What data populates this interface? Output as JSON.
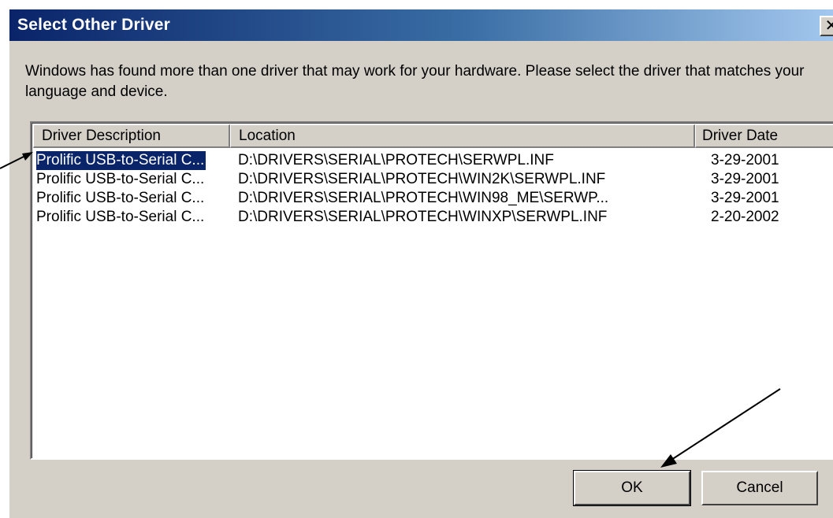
{
  "dialog": {
    "title": "Select Other Driver",
    "close_glyph": "✕",
    "message": "Windows has found more than one driver that may work for your hardware.  Please select the driver that matches your language and device."
  },
  "list": {
    "columns": [
      "Driver Description",
      "Location",
      "Driver Date"
    ],
    "rows": [
      {
        "description": "Prolific USB-to-Serial C...",
        "location": "D:\\DRIVERS\\SERIAL\\PROTECH\\SERWPL.INF",
        "date": "3-29-2001",
        "selected": true
      },
      {
        "description": "Prolific USB-to-Serial C...",
        "location": "D:\\DRIVERS\\SERIAL\\PROTECH\\WIN2K\\SERWPL.INF",
        "date": "3-29-2001",
        "selected": false
      },
      {
        "description": "Prolific USB-to-Serial C...",
        "location": "D:\\DRIVERS\\SERIAL\\PROTECH\\WIN98_ME\\SERWP...",
        "date": "3-29-2001",
        "selected": false
      },
      {
        "description": "Prolific USB-to-Serial C...",
        "location": "D:\\DRIVERS\\SERIAL\\PROTECH\\WINXP\\SERWPL.INF",
        "date": "2-20-2002",
        "selected": false
      }
    ]
  },
  "buttons": {
    "ok": "OK",
    "cancel": "Cancel"
  },
  "colors": {
    "title_bar_start": "#0a246a",
    "title_bar_end": "#a6caf0",
    "dialog_face": "#d4d0c8",
    "selection": "#0a246a"
  },
  "icons": {
    "close": "close-icon",
    "annotation_arrows": "arrow-icon"
  }
}
